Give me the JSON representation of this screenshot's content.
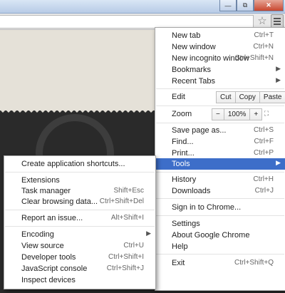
{
  "window": {
    "controls": {
      "minimize": "—",
      "maximize": "⧉",
      "close": "✕"
    }
  },
  "toolbar": {
    "star_icon": "star-icon",
    "menu_icon": "wrench-menu-icon"
  },
  "main_menu": {
    "new_tab": {
      "label": "New tab",
      "shortcut": "Ctrl+T"
    },
    "new_window": {
      "label": "New window",
      "shortcut": "Ctrl+N"
    },
    "new_incognito": {
      "label": "New incognito window",
      "shortcut": "Ctrl+Shift+N"
    },
    "bookmarks": {
      "label": "Bookmarks"
    },
    "recent_tabs": {
      "label": "Recent Tabs"
    },
    "edit": {
      "label": "Edit",
      "cut": "Cut",
      "copy": "Copy",
      "paste": "Paste"
    },
    "zoom": {
      "label": "Zoom",
      "minus": "−",
      "value": "100%",
      "plus": "+",
      "fullscreen": "⛶"
    },
    "save_page": {
      "label": "Save page as...",
      "shortcut": "Ctrl+S"
    },
    "find": {
      "label": "Find...",
      "shortcut": "Ctrl+F"
    },
    "print": {
      "label": "Print...",
      "shortcut": "Ctrl+P"
    },
    "tools": {
      "label": "Tools"
    },
    "history": {
      "label": "History",
      "shortcut": "Ctrl+H"
    },
    "downloads": {
      "label": "Downloads",
      "shortcut": "Ctrl+J"
    },
    "sign_in": {
      "label": "Sign in to Chrome..."
    },
    "settings": {
      "label": "Settings"
    },
    "about": {
      "label": "About Google Chrome"
    },
    "help": {
      "label": "Help"
    },
    "exit": {
      "label": "Exit",
      "shortcut": "Ctrl+Shift+Q"
    }
  },
  "tools_menu": {
    "create_shortcuts": {
      "label": "Create application shortcuts..."
    },
    "extensions": {
      "label": "Extensions"
    },
    "task_manager": {
      "label": "Task manager",
      "shortcut": "Shift+Esc"
    },
    "clear_data": {
      "label": "Clear browsing data...",
      "shortcut": "Ctrl+Shift+Del"
    },
    "report_issue": {
      "label": "Report an issue...",
      "shortcut": "Alt+Shift+I"
    },
    "encoding": {
      "label": "Encoding"
    },
    "view_source": {
      "label": "View source",
      "shortcut": "Ctrl+U"
    },
    "dev_tools": {
      "label": "Developer tools",
      "shortcut": "Ctrl+Shift+I"
    },
    "js_console": {
      "label": "JavaScript console",
      "shortcut": "Ctrl+Shift+J"
    },
    "inspect_devices": {
      "label": "Inspect devices"
    }
  },
  "colors": {
    "highlight": "#3d6ec9",
    "page_dark": "#2a2a2a",
    "paper": "#e5e1d8"
  }
}
